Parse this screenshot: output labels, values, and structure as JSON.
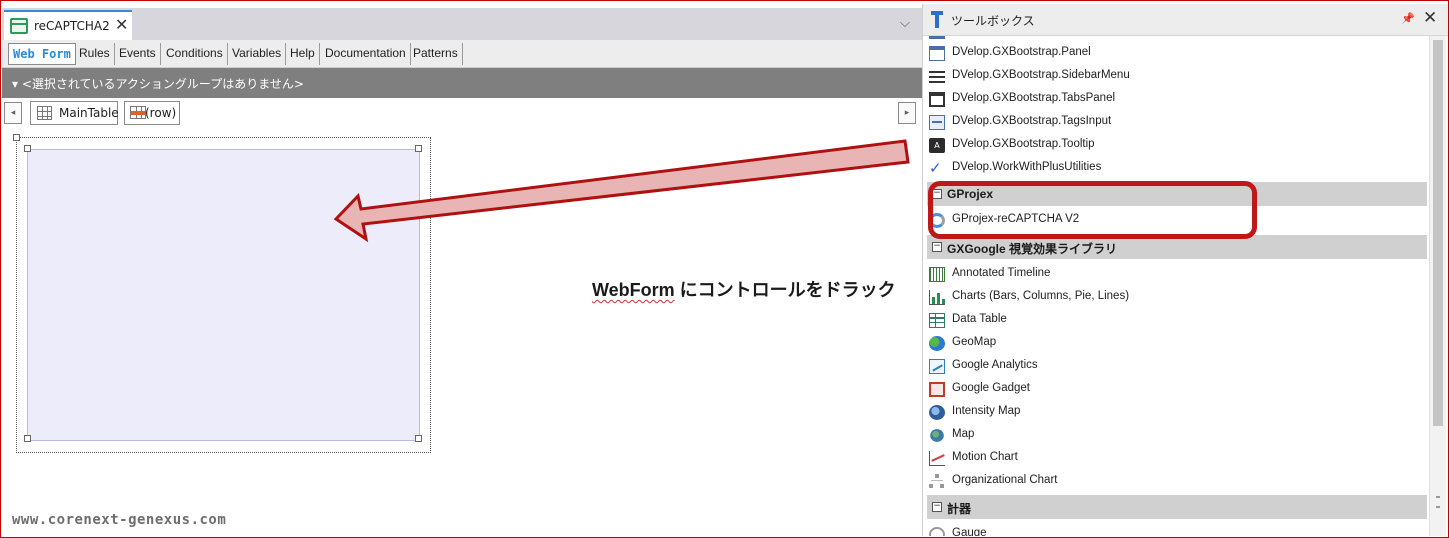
{
  "editor": {
    "doc_tab": {
      "title": "reCAPTCHA2",
      "close": "✕"
    },
    "tab_dropdown": "⌵",
    "subtabs": [
      "Web Form",
      "Rules",
      "Events",
      "Conditions",
      "Variables",
      "Help",
      "Documentation",
      "Patterns"
    ],
    "action_group": "▾ <選択されているアクショングループはありません>",
    "breadcrumb": {
      "left_arrow": "◂",
      "right_arrow": "▸",
      "main_table": "MainTable",
      "row": "(row)"
    },
    "caption": {
      "underlined": "WebForm",
      "rest": " にコントロールをドラック"
    },
    "watermark": "www.corenext-genexus.com"
  },
  "toolbox": {
    "title": "ツールボックス",
    "pin": "📌",
    "close": "✕",
    "items_top": [
      {
        "label": "DVelop.GXBootstrap.Panel",
        "icon": "panel-icon"
      },
      {
        "label": "DVelop.GXBootstrap.SidebarMenu",
        "icon": "sidebar-menu-icon"
      },
      {
        "label": "DVelop.GXBootstrap.TabsPanel",
        "icon": "tabs-panel-icon"
      },
      {
        "label": "DVelop.GXBootstrap.TagsInput",
        "icon": "tags-input-icon"
      },
      {
        "label": "DVelop.GXBootstrap.Tooltip",
        "icon": "tooltip-icon",
        "glyph": "A"
      },
      {
        "label": "DVelop.WorkWithPlusUtilities",
        "icon": "checkmark-icon",
        "glyph": "✓"
      }
    ],
    "group_gprojex": {
      "label": "GProjex",
      "toggle": "−"
    },
    "items_gprojex": [
      {
        "label": "GProjex-reCAPTCHA V2",
        "icon": "recaptcha-icon"
      }
    ],
    "group_gxgoogle": {
      "label": "GXGoogle 視覚効果ライブラリ",
      "toggle": "−"
    },
    "items_gxgoogle": [
      {
        "label": "Annotated Timeline",
        "icon": "timeline-icon"
      },
      {
        "label": "Charts (Bars, Columns, Pie, Lines)",
        "icon": "charts-icon"
      },
      {
        "label": "Data Table",
        "icon": "data-table-icon"
      },
      {
        "label": "GeoMap",
        "icon": "geomap-icon"
      },
      {
        "label": "Google Analytics",
        "icon": "analytics-icon"
      },
      {
        "label": "Google Gadget",
        "icon": "gadget-icon"
      },
      {
        "label": "Intensity Map",
        "icon": "intensity-map-icon"
      },
      {
        "label": "Map",
        "icon": "map-icon"
      },
      {
        "label": "Motion Chart",
        "icon": "motion-chart-icon"
      },
      {
        "label": "Organizational Chart",
        "icon": "org-chart-icon"
      }
    ],
    "group_gauge": {
      "label": "計器",
      "toggle": "−"
    },
    "items_gauge": [
      {
        "label": "Gauge",
        "icon": "gauge-icon"
      }
    ]
  },
  "colors": {
    "highlight": "#c01818",
    "arrow_fill": "#e8b4b4",
    "arrow_stroke": "#b01010",
    "accent": "#2a8ad6"
  }
}
